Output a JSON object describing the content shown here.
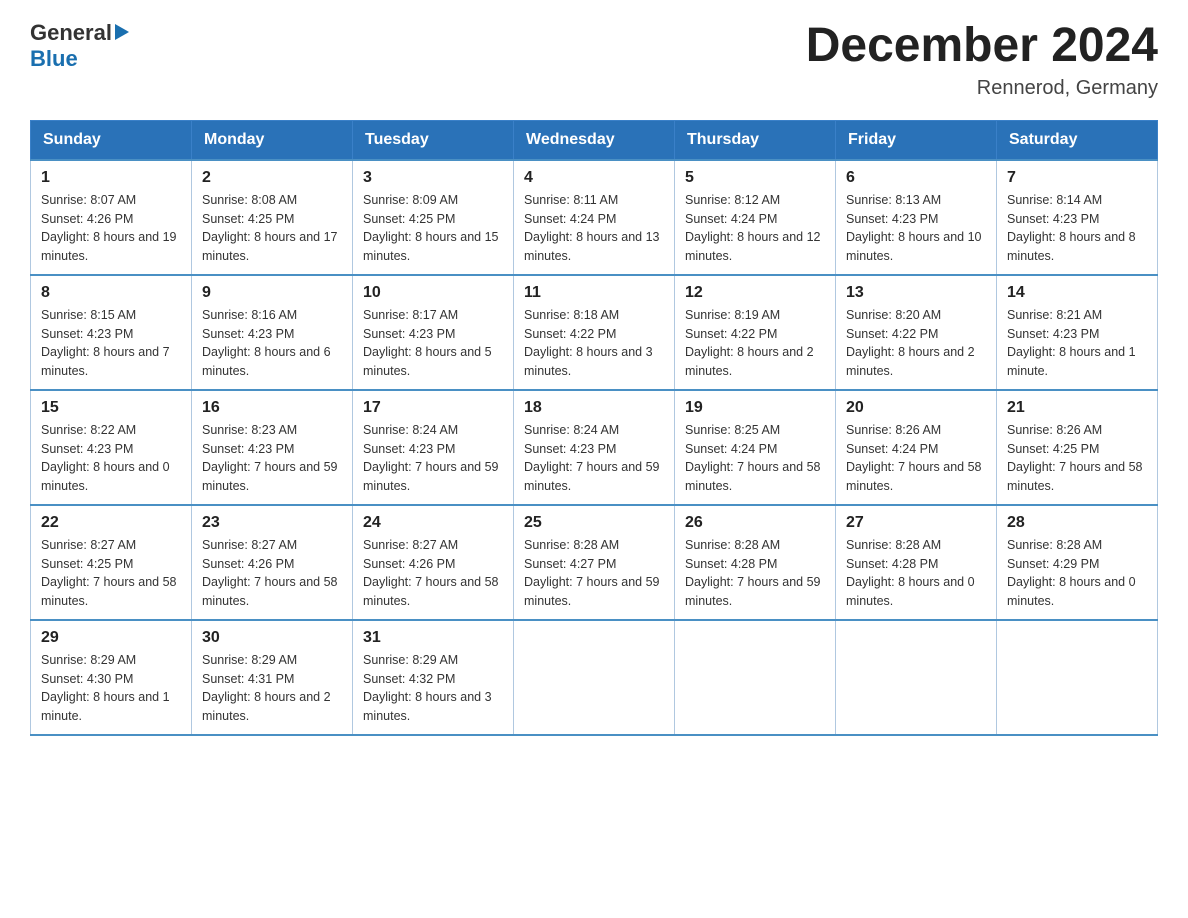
{
  "logo": {
    "text_general": "General",
    "text_blue": "Blue"
  },
  "header": {
    "month_year": "December 2024",
    "location": "Rennerod, Germany"
  },
  "weekdays": [
    "Sunday",
    "Monday",
    "Tuesday",
    "Wednesday",
    "Thursday",
    "Friday",
    "Saturday"
  ],
  "weeks": [
    [
      {
        "day": "1",
        "sunrise": "8:07 AM",
        "sunset": "4:26 PM",
        "daylight": "8 hours and 19 minutes."
      },
      {
        "day": "2",
        "sunrise": "8:08 AM",
        "sunset": "4:25 PM",
        "daylight": "8 hours and 17 minutes."
      },
      {
        "day": "3",
        "sunrise": "8:09 AM",
        "sunset": "4:25 PM",
        "daylight": "8 hours and 15 minutes."
      },
      {
        "day": "4",
        "sunrise": "8:11 AM",
        "sunset": "4:24 PM",
        "daylight": "8 hours and 13 minutes."
      },
      {
        "day": "5",
        "sunrise": "8:12 AM",
        "sunset": "4:24 PM",
        "daylight": "8 hours and 12 minutes."
      },
      {
        "day": "6",
        "sunrise": "8:13 AM",
        "sunset": "4:23 PM",
        "daylight": "8 hours and 10 minutes."
      },
      {
        "day": "7",
        "sunrise": "8:14 AM",
        "sunset": "4:23 PM",
        "daylight": "8 hours and 8 minutes."
      }
    ],
    [
      {
        "day": "8",
        "sunrise": "8:15 AM",
        "sunset": "4:23 PM",
        "daylight": "8 hours and 7 minutes."
      },
      {
        "day": "9",
        "sunrise": "8:16 AM",
        "sunset": "4:23 PM",
        "daylight": "8 hours and 6 minutes."
      },
      {
        "day": "10",
        "sunrise": "8:17 AM",
        "sunset": "4:23 PM",
        "daylight": "8 hours and 5 minutes."
      },
      {
        "day": "11",
        "sunrise": "8:18 AM",
        "sunset": "4:22 PM",
        "daylight": "8 hours and 3 minutes."
      },
      {
        "day": "12",
        "sunrise": "8:19 AM",
        "sunset": "4:22 PM",
        "daylight": "8 hours and 2 minutes."
      },
      {
        "day": "13",
        "sunrise": "8:20 AM",
        "sunset": "4:22 PM",
        "daylight": "8 hours and 2 minutes."
      },
      {
        "day": "14",
        "sunrise": "8:21 AM",
        "sunset": "4:23 PM",
        "daylight": "8 hours and 1 minute."
      }
    ],
    [
      {
        "day": "15",
        "sunrise": "8:22 AM",
        "sunset": "4:23 PM",
        "daylight": "8 hours and 0 minutes."
      },
      {
        "day": "16",
        "sunrise": "8:23 AM",
        "sunset": "4:23 PM",
        "daylight": "7 hours and 59 minutes."
      },
      {
        "day": "17",
        "sunrise": "8:24 AM",
        "sunset": "4:23 PM",
        "daylight": "7 hours and 59 minutes."
      },
      {
        "day": "18",
        "sunrise": "8:24 AM",
        "sunset": "4:23 PM",
        "daylight": "7 hours and 59 minutes."
      },
      {
        "day": "19",
        "sunrise": "8:25 AM",
        "sunset": "4:24 PM",
        "daylight": "7 hours and 58 minutes."
      },
      {
        "day": "20",
        "sunrise": "8:26 AM",
        "sunset": "4:24 PM",
        "daylight": "7 hours and 58 minutes."
      },
      {
        "day": "21",
        "sunrise": "8:26 AM",
        "sunset": "4:25 PM",
        "daylight": "7 hours and 58 minutes."
      }
    ],
    [
      {
        "day": "22",
        "sunrise": "8:27 AM",
        "sunset": "4:25 PM",
        "daylight": "7 hours and 58 minutes."
      },
      {
        "day": "23",
        "sunrise": "8:27 AM",
        "sunset": "4:26 PM",
        "daylight": "7 hours and 58 minutes."
      },
      {
        "day": "24",
        "sunrise": "8:27 AM",
        "sunset": "4:26 PM",
        "daylight": "7 hours and 58 minutes."
      },
      {
        "day": "25",
        "sunrise": "8:28 AM",
        "sunset": "4:27 PM",
        "daylight": "7 hours and 59 minutes."
      },
      {
        "day": "26",
        "sunrise": "8:28 AM",
        "sunset": "4:28 PM",
        "daylight": "7 hours and 59 minutes."
      },
      {
        "day": "27",
        "sunrise": "8:28 AM",
        "sunset": "4:28 PM",
        "daylight": "8 hours and 0 minutes."
      },
      {
        "day": "28",
        "sunrise": "8:28 AM",
        "sunset": "4:29 PM",
        "daylight": "8 hours and 0 minutes."
      }
    ],
    [
      {
        "day": "29",
        "sunrise": "8:29 AM",
        "sunset": "4:30 PM",
        "daylight": "8 hours and 1 minute."
      },
      {
        "day": "30",
        "sunrise": "8:29 AM",
        "sunset": "4:31 PM",
        "daylight": "8 hours and 2 minutes."
      },
      {
        "day": "31",
        "sunrise": "8:29 AM",
        "sunset": "4:32 PM",
        "daylight": "8 hours and 3 minutes."
      },
      null,
      null,
      null,
      null
    ]
  ],
  "labels": {
    "sunrise": "Sunrise:",
    "sunset": "Sunset:",
    "daylight": "Daylight:"
  }
}
